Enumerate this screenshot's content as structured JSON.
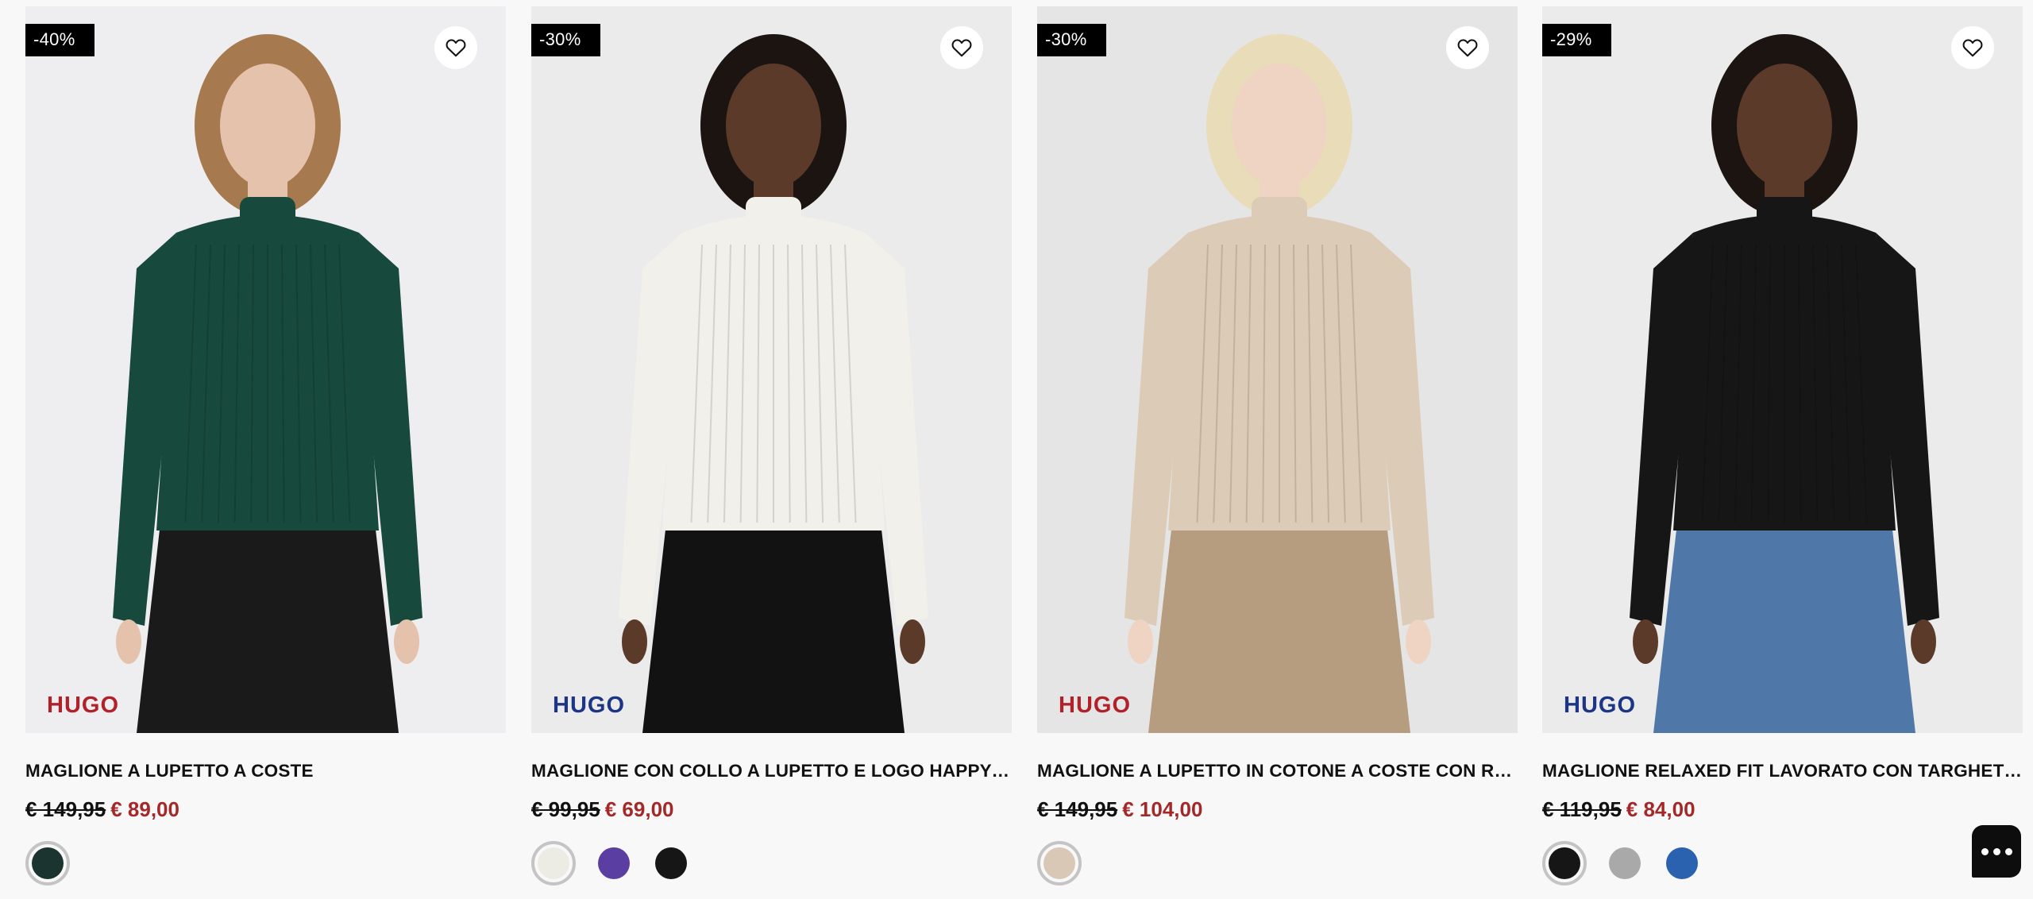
{
  "products": [
    {
      "discount": "-40%",
      "brand": "HUGO",
      "brand_color": "#b0212a",
      "title": "MAGLIONE A LUPETTO A COSTE",
      "old_price": "€ 149,95",
      "new_price": "€ 89,00",
      "price_color": "#a52828",
      "colors": [
        "#1c3430"
      ],
      "image": {
        "bg": "#eeeef0",
        "garment": "#17493c",
        "bottom": "#1a1a1a",
        "hair": "#a67a4e",
        "skin": "#e5c2ac"
      }
    },
    {
      "discount": "-30%",
      "brand": "HUGO",
      "brand_color": "#1c3585",
      "title": "MAGLIONE CON COLLO A LUPETTO E LOGO HAPPY HUGO",
      "old_price": "€ 99,95",
      "new_price": "€ 69,00",
      "price_color": "#a52828",
      "colors": [
        "#ecebe4",
        "#5b3ea2",
        "#161616"
      ],
      "image": {
        "bg": "#ebebec",
        "garment": "#f1f0ea",
        "bottom": "#121212",
        "hair": "#1c1410",
        "skin": "#5b3a29"
      }
    },
    {
      "discount": "-30%",
      "brand": "HUGO",
      "brand_color": "#b0212a",
      "title": "MAGLIONE A LUPETTO IN COTONE A COSTE CON RUCHES",
      "old_price": "€ 149,95",
      "new_price": "€ 104,00",
      "price_color": "#a52828",
      "colors": [
        "#d9c8b6"
      ],
      "image": {
        "bg": "#e6e5e5",
        "garment": "#dccbb6",
        "bottom": "#b79d80",
        "hair": "#e9dcb9",
        "skin": "#efd3c3"
      }
    },
    {
      "discount": "-29%",
      "brand": "HUGO",
      "brand_color": "#1c3585",
      "title": "MAGLIONE RELAXED FIT LAVORATO CON TARGHETTA LOGO",
      "old_price": "€ 119,95",
      "new_price": "€ 84,00",
      "price_color": "#a52828",
      "colors": [
        "#161616",
        "#a9a9a9",
        "#2b62b0"
      ],
      "image": {
        "bg": "#ecebec",
        "garment": "#161616",
        "bottom": "#4f77a8",
        "hair": "#1c1410",
        "skin": "#5b3a29"
      }
    }
  ],
  "icons": {
    "favorite": "heart-icon",
    "chat": "chat-icon"
  }
}
